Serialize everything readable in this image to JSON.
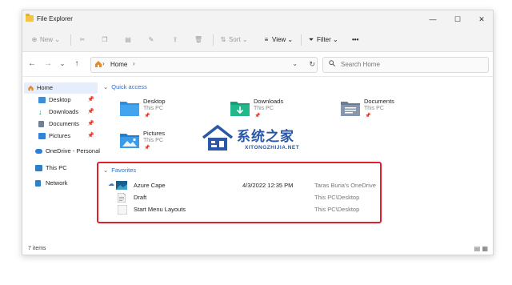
{
  "window": {
    "title": "File Explorer",
    "controls": {
      "minimize": "—",
      "maximize": "☐",
      "close": "✕"
    }
  },
  "toolbar": {
    "new_label": "New",
    "sort_label": "Sort",
    "view_label": "View",
    "filter_label": "Filter",
    "more_label": "•••"
  },
  "address": {
    "path": "Home",
    "search_placeholder": "Search Home"
  },
  "sidebar": {
    "items": [
      {
        "label": "Home",
        "icon": "home-icon",
        "selected": true,
        "pinned": false
      },
      {
        "label": "Desktop",
        "icon": "desktop-folder-icon",
        "pinned": true
      },
      {
        "label": "Downloads",
        "icon": "downloads-folder-icon",
        "pinned": true
      },
      {
        "label": "Documents",
        "icon": "documents-folder-icon",
        "pinned": true
      },
      {
        "label": "Pictures",
        "icon": "pictures-folder-icon",
        "pinned": true
      },
      {
        "label": "OneDrive - Personal",
        "icon": "onedrive-icon",
        "pinned": false
      },
      {
        "label": "This PC",
        "icon": "this-pc-icon",
        "pinned": false
      },
      {
        "label": "Network",
        "icon": "network-icon",
        "pinned": false
      }
    ]
  },
  "quick_access": {
    "heading": "Quick access",
    "items": [
      {
        "name": "Desktop",
        "location": "This PC",
        "icon": "desktop-folder-icon"
      },
      {
        "name": "Downloads",
        "location": "This PC",
        "icon": "downloads-folder-icon"
      },
      {
        "name": "Documents",
        "location": "This PC",
        "icon": "documents-folder-icon"
      },
      {
        "name": "Pictures",
        "location": "This PC",
        "icon": "pictures-folder-icon"
      }
    ]
  },
  "favorites": {
    "heading": "Favorites",
    "rows": [
      {
        "name": "Azure Cape",
        "date": "4/3/2022 12:35 PM",
        "location": "Taras Buria's OneDrive",
        "icon": "image-file-icon",
        "sync": "cloud-icon"
      },
      {
        "name": "Draft",
        "date": "",
        "location": "This PC\\Desktop",
        "icon": "document-file-icon"
      },
      {
        "name": "Start Menu Layouts",
        "date": "",
        "location": "This PC\\Desktop",
        "icon": "generic-file-icon"
      }
    ]
  },
  "status": {
    "item_count": "7 items"
  },
  "watermark": {
    "title": "系统之家",
    "url": "XITONGZHIJIA.NET"
  },
  "colors": {
    "accent": "#2a6fd6",
    "highlight": "#e0202a",
    "folder": "#f4c542"
  }
}
